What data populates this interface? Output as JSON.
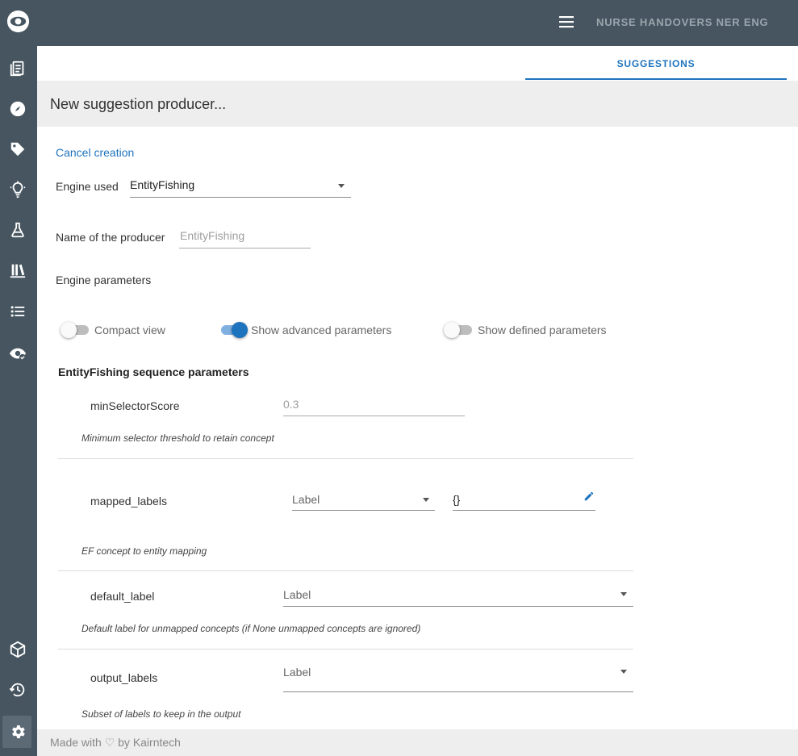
{
  "header": {
    "project_title": "NURSE HANDOVERS NER ENG"
  },
  "tabs": [
    {
      "label": "SUGGESTIONS"
    }
  ],
  "page": {
    "title": "New suggestion producer..."
  },
  "form": {
    "cancel_label": "Cancel creation",
    "engine_label": "Engine used",
    "engine_value": "EntityFishing",
    "name_label": "Name of the producer",
    "name_placeholder": "EntityFishing",
    "params_label": "Engine parameters"
  },
  "toggles": {
    "compact_view": {
      "label": "Compact view",
      "on": false
    },
    "advanced": {
      "label": "Show advanced parameters",
      "on": true
    },
    "defined": {
      "label": "Show defined parameters",
      "on": false
    }
  },
  "section": {
    "title": "EntityFishing sequence parameters"
  },
  "params": {
    "min_selector_score": {
      "name": "minSelectorScore",
      "placeholder": "0.3",
      "help": "Minimum selector threshold to retain concept"
    },
    "mapped_labels": {
      "name": "mapped_labels",
      "select_placeholder": "Label",
      "value": "{}",
      "help": "EF concept to entity mapping"
    },
    "default_label": {
      "name": "default_label",
      "select_placeholder": "Label",
      "help": "Default label for unmapped concepts (if None unmapped concepts are ignored)"
    },
    "output_labels": {
      "name": "output_labels",
      "select_placeholder": "Label",
      "help": "Subset of labels to keep in the output"
    }
  },
  "footer": {
    "text": "Made with ♡ by Kairntech"
  },
  "sidebar": {
    "icons": [
      "documents-icon",
      "compass-icon",
      "tag-icon",
      "lightbulb-icon",
      "flask-icon",
      "library-icon",
      "list-icon",
      "eye-check-icon",
      "cube-icon",
      "history-icon",
      "settings-icon"
    ]
  },
  "colors": {
    "sidebar": "#46555f",
    "accent": "#1e73be",
    "panel": "#eeeeee"
  }
}
